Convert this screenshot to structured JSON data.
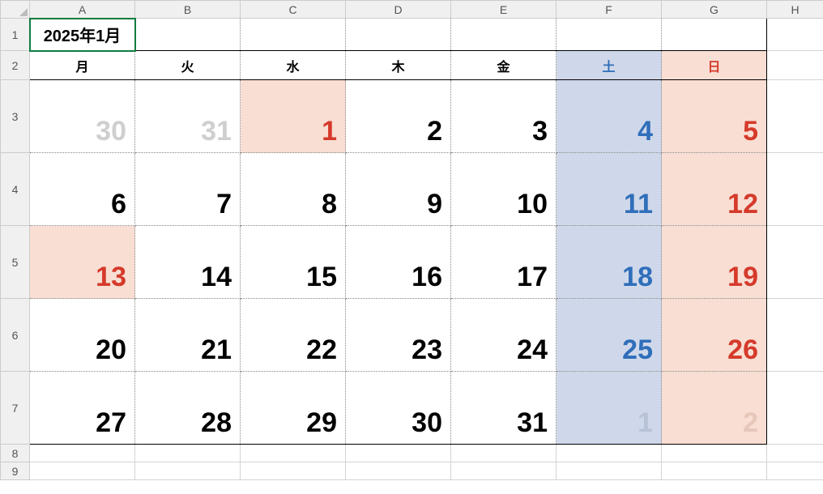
{
  "columns": [
    "A",
    "B",
    "C",
    "D",
    "E",
    "F",
    "G",
    "H"
  ],
  "rows": [
    "1",
    "2",
    "3",
    "4",
    "5",
    "6",
    "7",
    "8",
    "9"
  ],
  "title": "2025年1月",
  "dow": [
    "月",
    "火",
    "水",
    "木",
    "金",
    "土",
    "日"
  ],
  "weeks": [
    [
      {
        "n": "30",
        "cls": "muted"
      },
      {
        "n": "31",
        "cls": "muted"
      },
      {
        "n": "1",
        "cls": "holiday"
      },
      {
        "n": "2",
        "cls": ""
      },
      {
        "n": "3",
        "cls": ""
      },
      {
        "n": "4",
        "cls": "sat-col"
      },
      {
        "n": "5",
        "cls": "sun-col"
      }
    ],
    [
      {
        "n": "6",
        "cls": ""
      },
      {
        "n": "7",
        "cls": ""
      },
      {
        "n": "8",
        "cls": ""
      },
      {
        "n": "9",
        "cls": ""
      },
      {
        "n": "10",
        "cls": ""
      },
      {
        "n": "11",
        "cls": "sat-col"
      },
      {
        "n": "12",
        "cls": "sun-col"
      }
    ],
    [
      {
        "n": "13",
        "cls": "holiday"
      },
      {
        "n": "14",
        "cls": ""
      },
      {
        "n": "15",
        "cls": ""
      },
      {
        "n": "16",
        "cls": ""
      },
      {
        "n": "17",
        "cls": ""
      },
      {
        "n": "18",
        "cls": "sat-col"
      },
      {
        "n": "19",
        "cls": "sun-col"
      }
    ],
    [
      {
        "n": "20",
        "cls": ""
      },
      {
        "n": "21",
        "cls": ""
      },
      {
        "n": "22",
        "cls": ""
      },
      {
        "n": "23",
        "cls": ""
      },
      {
        "n": "24",
        "cls": ""
      },
      {
        "n": "25",
        "cls": "sat-col"
      },
      {
        "n": "26",
        "cls": "sun-col"
      }
    ],
    [
      {
        "n": "27",
        "cls": ""
      },
      {
        "n": "28",
        "cls": ""
      },
      {
        "n": "29",
        "cls": ""
      },
      {
        "n": "30",
        "cls": ""
      },
      {
        "n": "31",
        "cls": ""
      },
      {
        "n": "1",
        "cls": "muted-sat"
      },
      {
        "n": "2",
        "cls": "muted-sun"
      }
    ]
  ]
}
